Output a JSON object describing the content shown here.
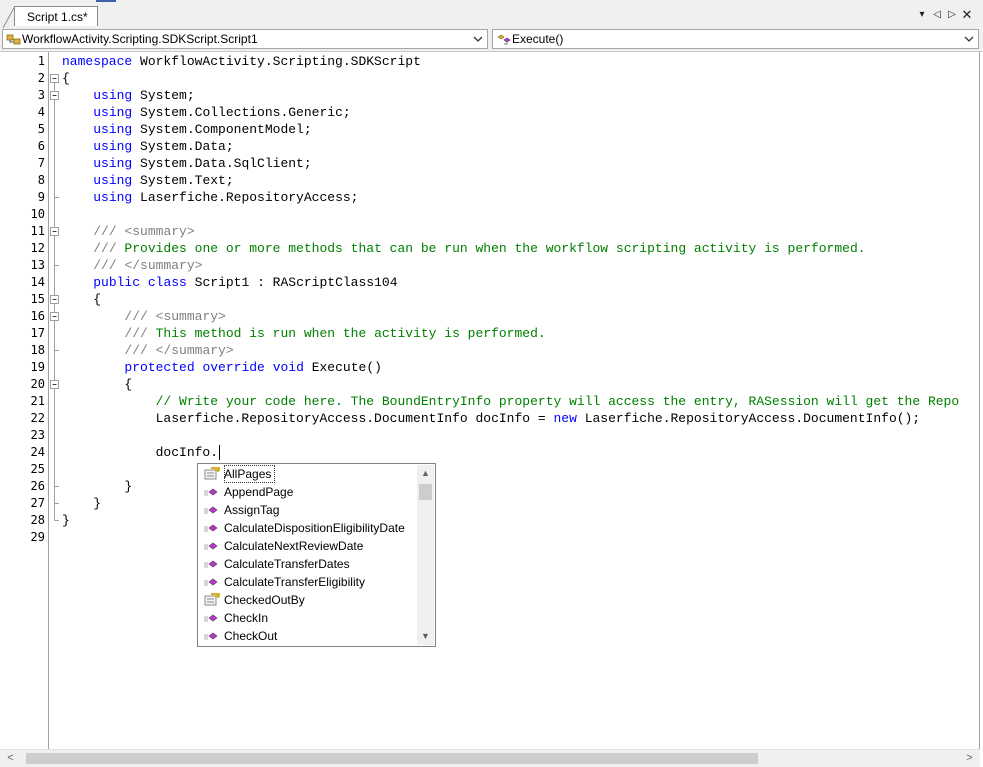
{
  "tab": {
    "title": "Script 1.cs*"
  },
  "tab_controls": {
    "dropdown": "▾",
    "prev": "◁",
    "next": "▷",
    "close": "✕"
  },
  "navbar": {
    "type_combo": "WorkflowActivity.Scripting.SDKScript.Script1",
    "member_combo": "Execute()"
  },
  "editor": {
    "line_numbers": [
      "1",
      "2",
      "3",
      "4",
      "5",
      "6",
      "7",
      "8",
      "9",
      "10",
      "11",
      "12",
      "13",
      "14",
      "15",
      "16",
      "17",
      "18",
      "19",
      "20",
      "21",
      "22",
      "23",
      "24",
      "25",
      "26",
      "27",
      "28",
      "29"
    ],
    "lines": [
      [
        {
          "t": "kw",
          "v": "namespace"
        },
        {
          "t": "n",
          "v": " WorkflowActivity.Scripting.SDKScript"
        }
      ],
      [
        {
          "t": "n",
          "v": "{"
        }
      ],
      [
        {
          "t": "n",
          "v": "    "
        },
        {
          "t": "kw",
          "v": "using"
        },
        {
          "t": "n",
          "v": " System;"
        }
      ],
      [
        {
          "t": "n",
          "v": "    "
        },
        {
          "t": "kw",
          "v": "using"
        },
        {
          "t": "n",
          "v": " System.Collections.Generic;"
        }
      ],
      [
        {
          "t": "n",
          "v": "    "
        },
        {
          "t": "kw",
          "v": "using"
        },
        {
          "t": "n",
          "v": " System.ComponentModel;"
        }
      ],
      [
        {
          "t": "n",
          "v": "    "
        },
        {
          "t": "kw",
          "v": "using"
        },
        {
          "t": "n",
          "v": " System.Data;"
        }
      ],
      [
        {
          "t": "n",
          "v": "    "
        },
        {
          "t": "kw",
          "v": "using"
        },
        {
          "t": "n",
          "v": " System.Data.SqlClient;"
        }
      ],
      [
        {
          "t": "n",
          "v": "    "
        },
        {
          "t": "kw",
          "v": "using"
        },
        {
          "t": "n",
          "v": " System.Text;"
        }
      ],
      [
        {
          "t": "n",
          "v": "    "
        },
        {
          "t": "kw",
          "v": "using"
        },
        {
          "t": "n",
          "v": " Laserfiche.RepositoryAccess;"
        }
      ],
      [],
      [
        {
          "t": "n",
          "v": "    "
        },
        {
          "t": "xt",
          "v": "///"
        },
        {
          "t": "cm",
          "v": " "
        },
        {
          "t": "xt",
          "v": "<summary>"
        }
      ],
      [
        {
          "t": "n",
          "v": "    "
        },
        {
          "t": "xt",
          "v": "///"
        },
        {
          "t": "cm",
          "v": " Provides one or more methods that can be run when the workflow scripting activity is performed."
        }
      ],
      [
        {
          "t": "n",
          "v": "    "
        },
        {
          "t": "xt",
          "v": "///"
        },
        {
          "t": "cm",
          "v": " "
        },
        {
          "t": "xt",
          "v": "</summary>"
        }
      ],
      [
        {
          "t": "n",
          "v": "    "
        },
        {
          "t": "kw",
          "v": "public"
        },
        {
          "t": "n",
          "v": " "
        },
        {
          "t": "kw",
          "v": "class"
        },
        {
          "t": "n",
          "v": " Script1 : RAScriptClass104"
        }
      ],
      [
        {
          "t": "n",
          "v": "    {"
        }
      ],
      [
        {
          "t": "n",
          "v": "        "
        },
        {
          "t": "xt",
          "v": "///"
        },
        {
          "t": "cm",
          "v": " "
        },
        {
          "t": "xt",
          "v": "<summary>"
        }
      ],
      [
        {
          "t": "n",
          "v": "        "
        },
        {
          "t": "xt",
          "v": "///"
        },
        {
          "t": "cm",
          "v": " This method is run when the activity is performed."
        }
      ],
      [
        {
          "t": "n",
          "v": "        "
        },
        {
          "t": "xt",
          "v": "///"
        },
        {
          "t": "cm",
          "v": " "
        },
        {
          "t": "xt",
          "v": "</summary>"
        }
      ],
      [
        {
          "t": "n",
          "v": "        "
        },
        {
          "t": "kw",
          "v": "protected"
        },
        {
          "t": "n",
          "v": " "
        },
        {
          "t": "kw",
          "v": "override"
        },
        {
          "t": "n",
          "v": " "
        },
        {
          "t": "kw",
          "v": "void"
        },
        {
          "t": "n",
          "v": " Execute()"
        }
      ],
      [
        {
          "t": "n",
          "v": "        {"
        }
      ],
      [
        {
          "t": "n",
          "v": "            "
        },
        {
          "t": "cm",
          "v": "// Write your code here. The BoundEntryInfo property will access the entry, RASession will get the Repo"
        }
      ],
      [
        {
          "t": "n",
          "v": "            Laserfiche.RepositoryAccess.DocumentInfo docInfo = "
        },
        {
          "t": "kw",
          "v": "new"
        },
        {
          "t": "n",
          "v": " Laserfiche.RepositoryAccess.DocumentInfo();"
        }
      ],
      [],
      [
        {
          "t": "n",
          "v": "            docInfo."
        }
      ],
      [],
      [
        {
          "t": "n",
          "v": "        }"
        }
      ],
      [
        {
          "t": "n",
          "v": "    }"
        }
      ],
      [
        {
          "t": "n",
          "v": "}"
        }
      ],
      []
    ]
  },
  "completion": {
    "items": [
      {
        "label": "AllPages",
        "kind": "property",
        "selected": true
      },
      {
        "label": "AppendPage",
        "kind": "method"
      },
      {
        "label": "AssignTag",
        "kind": "method"
      },
      {
        "label": "CalculateDispositionEligibilityDate",
        "kind": "method"
      },
      {
        "label": "CalculateNextReviewDate",
        "kind": "method"
      },
      {
        "label": "CalculateTransferDates",
        "kind": "method"
      },
      {
        "label": "CalculateTransferEligibility",
        "kind": "method"
      },
      {
        "label": "CheckedOutBy",
        "kind": "property"
      },
      {
        "label": "CheckIn",
        "kind": "method"
      },
      {
        "label": "CheckOut",
        "kind": "method"
      }
    ],
    "scroll_up": "▲",
    "scroll_down": "▼"
  },
  "hscroll": {
    "left": "<",
    "right": ">"
  },
  "colors": {
    "keyword": "#0000ff",
    "comment": "#008000",
    "xml_doc_tag": "#808080",
    "method_icon": "#b040c0",
    "property_icon": "#d8b030"
  }
}
